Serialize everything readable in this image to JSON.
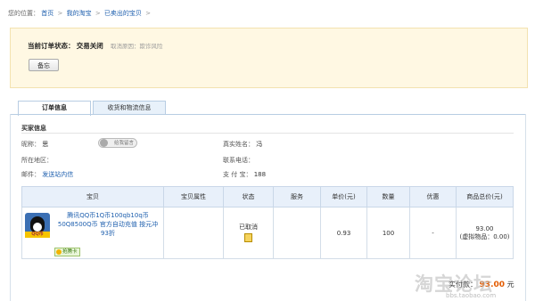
{
  "breadcrumb": {
    "prefix": "您的位置：",
    "items": [
      "首页",
      "我的淘宝",
      "已卖出的宝贝"
    ],
    "separator": ">"
  },
  "order_status": {
    "label": "当前订单状态：",
    "value": "交易关闭",
    "reason": "取消原因：欺诈风险",
    "memo_button": "备忘"
  },
  "tabs": [
    {
      "label": "订单信息",
      "active": true
    },
    {
      "label": "收货和物流信息",
      "active": false
    }
  ],
  "buyer": {
    "section_title": "买家信息",
    "nickname_label": "昵称：",
    "nickname_value": "思",
    "wangwang_label": "给我留言",
    "realname_label": "真实姓名：",
    "realname_value": "冯",
    "region_label": "所在地区：",
    "region_value": "",
    "phone_label": "联系电话：",
    "phone_value": "",
    "email_label": "邮件：",
    "email_value": "发送站内信",
    "alipay_label": "支 付 宝：",
    "alipay_value": "188"
  },
  "table": {
    "headers": [
      "宝贝",
      "宝贝属性",
      "状态",
      "服务",
      "单价(元)",
      "数量",
      "优惠",
      "商品总价(元)"
    ],
    "rows": [
      {
        "title": "腾讯QQ币1Q币100qb10q币50Q8500Q币 官方自动充值 按元冲93折",
        "thumb_label": "QQ币",
        "member_tag": "抢腾卡",
        "attribute": "",
        "status": "已取消",
        "service": "",
        "unit_price": "0.93",
        "quantity": "100",
        "discount": "-",
        "total": "93.00",
        "total_note": "(虚拟物品：0.00)"
      }
    ]
  },
  "summary": {
    "label": "实付款：",
    "amount": "93.00",
    "unit": "元"
  },
  "watermark": {
    "text": "淘宝论坛",
    "url": "bbs.taobao.com"
  },
  "colors": {
    "link": "#1e5fae",
    "status_bg": "#fff8e3",
    "table_header_bg": "#e8f0fa",
    "amount": "#e35b00"
  }
}
